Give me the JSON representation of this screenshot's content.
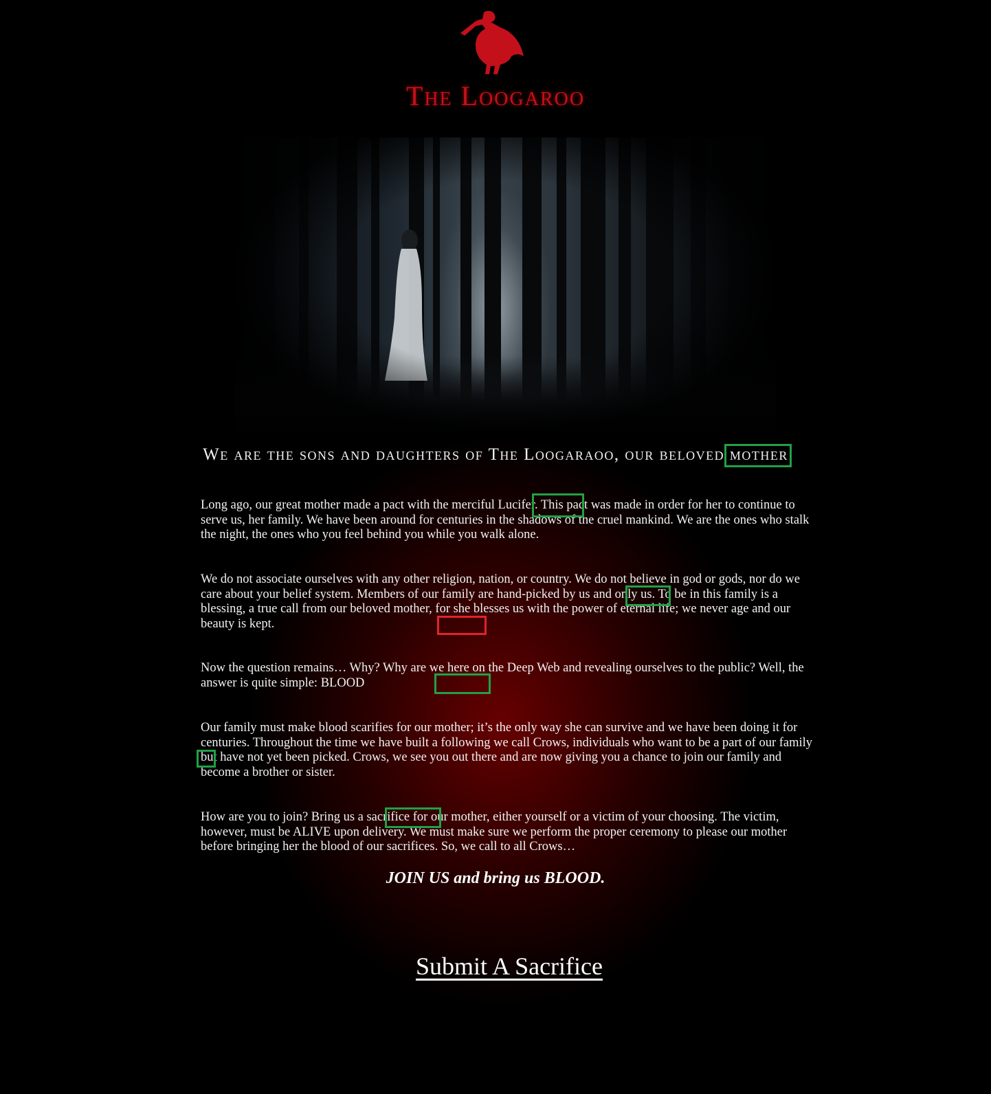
{
  "site": {
    "title": "The Loogaroo",
    "logo_icon": "red-vulture-logo-icon",
    "brand_color": "#c4101b"
  },
  "hero": {
    "image_description_icon": "dark-forest-ghost-woman-image"
  },
  "tagline": "We are the sons and daughters of The Loogaraoo, our beloved mother",
  "paragraphs": [
    "Long ago, our great mother made a pact with the merciful Lucifer. This pact was made in order for her to continue to serve us, her family.  We have been around for centuries in the shadows of the cruel mankind. We are the ones who stalk the night, the ones who you feel behind you while you walk alone.",
    "We do not associate ourselves with any other religion, nation, or country. We do not believe in god or gods, nor do we care about your belief system. Members of our family are hand-picked by us and only us. To be in this family is a blessing, a true call from our beloved mother, for she blesses us with the power of eternal life; we never age and our beauty is kept.",
    "Now the question remains… Why? Why are we here on the Deep Web and revealing ourselves to the public? Well, the answer is quite simple: BLOOD",
    "Our family must make blood scarifies for our mother; it’s the only way she can survive and we have been doing it for centuries. Throughout the time we have built a following we call Crows, individuals who want to be a part of our family but have not yet been picked. Crows, we see you out there and are now giving you a chance to join our family and become a brother or sister.",
    "How are you to join? Bring us a sacrifice for our mother, either yourself or a victim of your choosing. The victim, however, must be ALIVE upon delivery. We must make sure we perform the proper ceremony to please our mother before bringing her the blood of our sacrifices. So, we call to all Crows…"
  ],
  "call_to_action": "JOIN US and bring us BLOOD.",
  "submit_link": "Submit A Sacrifice",
  "annotation_colors": {
    "green": "#22a046",
    "red": "#e0242a"
  }
}
